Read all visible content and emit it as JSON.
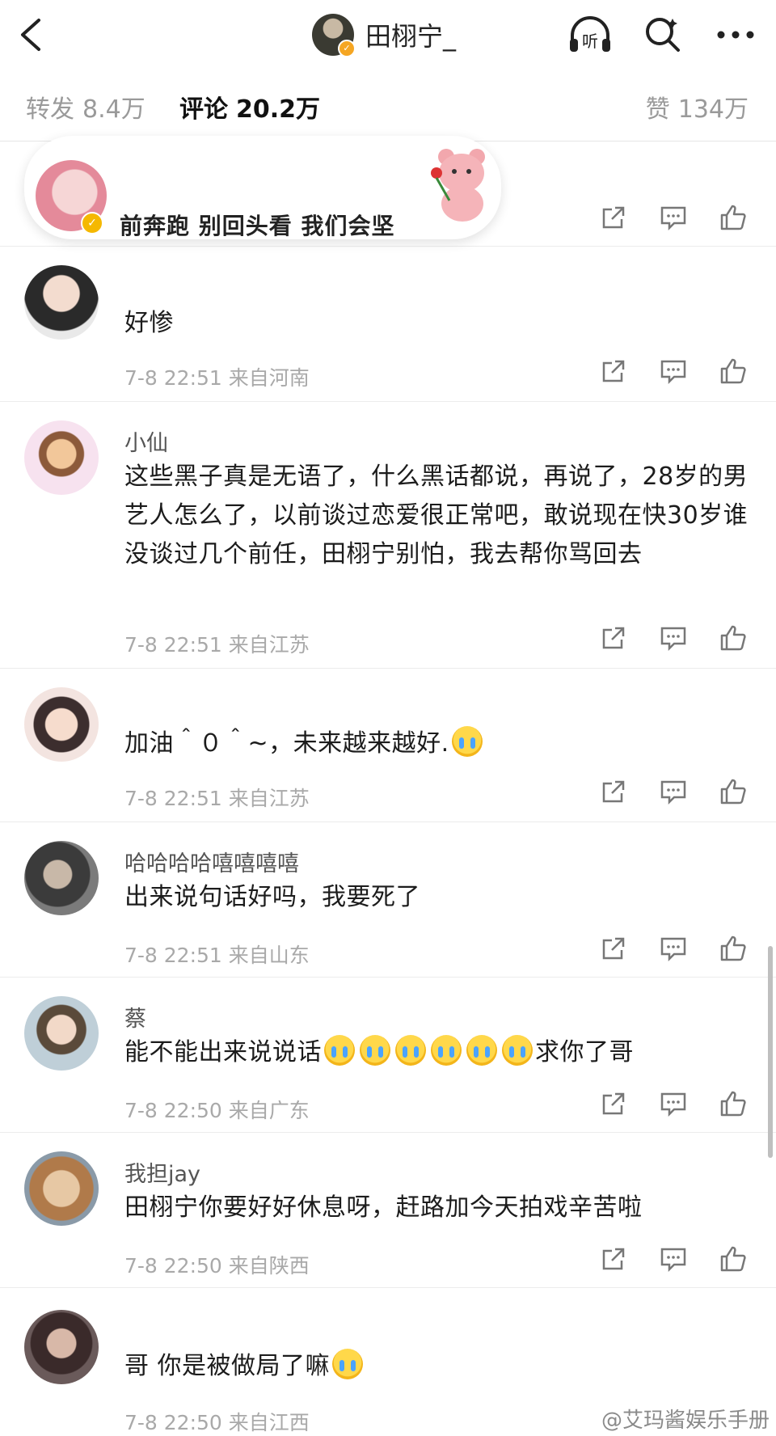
{
  "header": {
    "title": "田栩宁_",
    "icons": [
      "back-icon",
      "listen-icon",
      "search-icon",
      "more-icon"
    ],
    "listen_label": "听"
  },
  "tabs": {
    "repost_label": "转发",
    "repost_count": "8.4万",
    "comment_label": "评论",
    "comment_count": "20.2万",
    "like_label": "赞",
    "like_count": "134万"
  },
  "sticker_comment": {
    "text": "前奔跑 别回头看 我们会坚"
  },
  "comments": [
    {
      "username": "",
      "text": "好惨",
      "meta": "7-8 22:51 来自河南"
    },
    {
      "username": "小仙",
      "text": "这些黑子真是无语了，什么黑话都说，再说了，28岁的男艺人怎么了，以前谈过恋爱很正常吧，敢说现在快30岁谁没谈过几个前任，田栩宁别怕，我去帮你骂回去",
      "meta": "7-8 22:51 来自江苏"
    },
    {
      "username": "",
      "text": "加油＾０＾~，未来越来越好.",
      "meta": "7-8 22:51 来自江苏"
    },
    {
      "username": "哈哈哈哈嘻嘻嘻嘻",
      "text": "出来说句话好吗，我要死了",
      "meta": "7-8 22:51 来自山东"
    },
    {
      "username": "蔡",
      "text_a": "能不能出来说说话",
      "text_b": "求你了哥",
      "meta": "7-8 22:50 来自广东"
    },
    {
      "username": "我担jay",
      "text": "田栩宁你要好好休息呀，赶路加今天拍戏辛苦啦",
      "meta": "7-8 22:50 来自陕西"
    },
    {
      "username": "",
      "text": "哥 你是被做局了嘛",
      "meta": "7-8 22:50 来自江西"
    }
  ],
  "watermark": "@艾玛酱娱乐手册"
}
